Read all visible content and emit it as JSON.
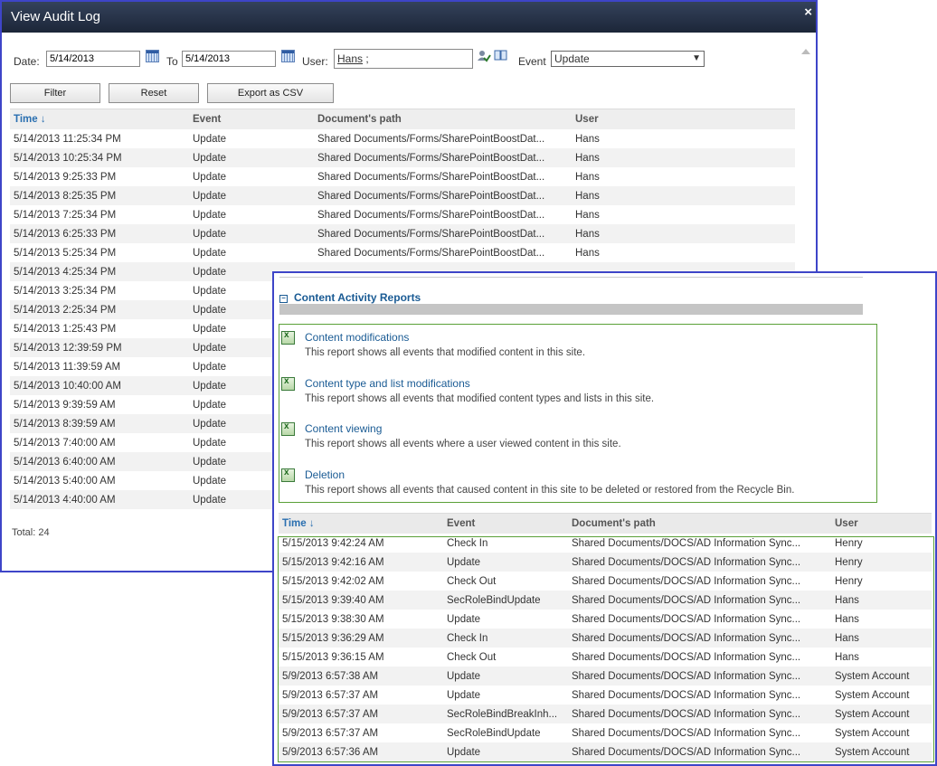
{
  "dialog": {
    "title": "View Audit Log",
    "close": "×",
    "filters": {
      "date_label": "Date:",
      "date_from": "5/14/2013",
      "to_label": "To",
      "date_to": "5/14/2013",
      "user_label": "User:",
      "user_value": "Hans",
      "user_suffix": " ;",
      "event_label": "Event",
      "event_value": "Update"
    },
    "buttons": {
      "filter": "Filter",
      "reset": "Reset",
      "export": "Export as CSV"
    },
    "columns": [
      "Time ↓",
      "Event",
      "Document's path",
      "User"
    ],
    "rows": [
      [
        "5/14/2013 11:25:34 PM",
        "Update",
        "Shared Documents/Forms/SharePointBoostDat...",
        "Hans"
      ],
      [
        "5/14/2013 10:25:34 PM",
        "Update",
        "Shared Documents/Forms/SharePointBoostDat...",
        "Hans"
      ],
      [
        "5/14/2013 9:25:33 PM",
        "Update",
        "Shared Documents/Forms/SharePointBoostDat...",
        "Hans"
      ],
      [
        "5/14/2013 8:25:35 PM",
        "Update",
        "Shared Documents/Forms/SharePointBoostDat...",
        "Hans"
      ],
      [
        "5/14/2013 7:25:34 PM",
        "Update",
        "Shared Documents/Forms/SharePointBoostDat...",
        "Hans"
      ],
      [
        "5/14/2013 6:25:33 PM",
        "Update",
        "Shared Documents/Forms/SharePointBoostDat...",
        "Hans"
      ],
      [
        "5/14/2013 5:25:34 PM",
        "Update",
        "Shared Documents/Forms/SharePointBoostDat...",
        "Hans"
      ],
      [
        "5/14/2013 4:25:34 PM",
        "Update",
        "",
        ""
      ],
      [
        "5/14/2013 3:25:34 PM",
        "Update",
        "",
        ""
      ],
      [
        "5/14/2013 2:25:34 PM",
        "Update",
        "",
        ""
      ],
      [
        "5/14/2013 1:25:43 PM",
        "Update",
        "",
        ""
      ],
      [
        "5/14/2013 12:39:59 PM",
        "Update",
        "",
        ""
      ],
      [
        "5/14/2013 11:39:59 AM",
        "Update",
        "",
        ""
      ],
      [
        "5/14/2013 10:40:00 AM",
        "Update",
        "",
        ""
      ],
      [
        "5/14/2013 9:39:59 AM",
        "Update",
        "",
        ""
      ],
      [
        "5/14/2013 8:39:59 AM",
        "Update",
        "",
        ""
      ],
      [
        "5/14/2013 7:40:00 AM",
        "Update",
        "",
        ""
      ],
      [
        "5/14/2013 6:40:00 AM",
        "Update",
        "",
        ""
      ],
      [
        "5/14/2013 5:40:00 AM",
        "Update",
        "",
        ""
      ],
      [
        "5/14/2013 4:40:00 AM",
        "Update",
        "",
        ""
      ]
    ],
    "total": "Total: 24"
  },
  "panel": {
    "section_title": "Content Activity Reports",
    "reports": [
      {
        "title": "Content modifications",
        "desc": "This report shows all events that modified content in this site."
      },
      {
        "title": "Content type and list modifications",
        "desc": "This report shows all events that modified content types and lists in this site."
      },
      {
        "title": "Content viewing",
        "desc": "This report shows all events where a user viewed content in this site."
      },
      {
        "title": "Deletion",
        "desc": "This report shows all events that caused content in this site to be deleted or restored from the Recycle Bin."
      }
    ],
    "columns": [
      "Time ↓",
      "Event",
      "Document's path",
      "User"
    ],
    "rows": [
      [
        "5/15/2013 9:42:24 AM",
        "Check In",
        "Shared Documents/DOCS/AD Information Sync...",
        "Henry"
      ],
      [
        "5/15/2013 9:42:16 AM",
        "Update",
        "Shared Documents/DOCS/AD Information Sync...",
        "Henry"
      ],
      [
        "5/15/2013 9:42:02 AM",
        "Check Out",
        "Shared Documents/DOCS/AD Information Sync...",
        "Henry"
      ],
      [
        "5/15/2013 9:39:40 AM",
        "SecRoleBindUpdate",
        "Shared Documents/DOCS/AD Information Sync...",
        "Hans"
      ],
      [
        "5/15/2013 9:38:30 AM",
        "Update",
        "Shared Documents/DOCS/AD Information Sync...",
        "Hans"
      ],
      [
        "5/15/2013 9:36:29 AM",
        "Check In",
        "Shared Documents/DOCS/AD Information Sync...",
        "Hans"
      ],
      [
        "5/15/2013 9:36:15 AM",
        "Check Out",
        "Shared Documents/DOCS/AD Information Sync...",
        "Hans"
      ],
      [
        "5/9/2013 6:57:38 AM",
        "Update",
        "Shared Documents/DOCS/AD Information Sync...",
        "System Account"
      ],
      [
        "5/9/2013 6:57:37 AM",
        "Update",
        "Shared Documents/DOCS/AD Information Sync...",
        "System Account"
      ],
      [
        "5/9/2013 6:57:37 AM",
        "SecRoleBindBreakInh...",
        "Shared Documents/DOCS/AD Information Sync...",
        "System Account"
      ],
      [
        "5/9/2013 6:57:37 AM",
        "SecRoleBindUpdate",
        "Shared Documents/DOCS/AD Information Sync...",
        "System Account"
      ],
      [
        "5/9/2013 6:57:36 AM",
        "Update",
        "Shared Documents/DOCS/AD Information Sync...",
        "System Account"
      ]
    ]
  }
}
